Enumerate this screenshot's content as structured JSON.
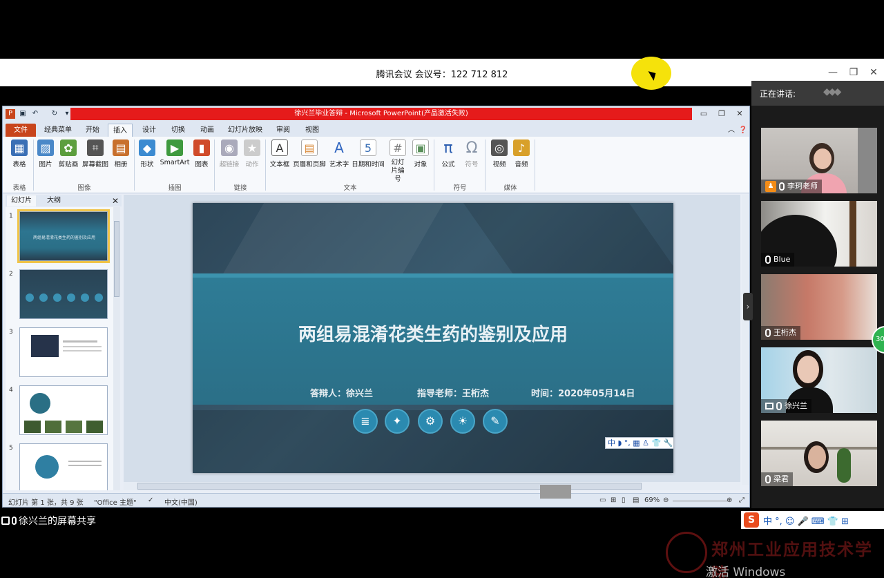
{
  "meeting": {
    "title": "腾讯会议 会议号：122 712 812"
  },
  "ppt": {
    "window_title": "徐兴兰毕业答辩 - Microsoft PowerPoint(产品激活失败)",
    "tabs": [
      "文件",
      "经典菜单",
      "开始",
      "插入",
      "设计",
      "切换",
      "动画",
      "幻灯片放映",
      "审阅",
      "视图"
    ],
    "ribbon_buttons": [
      {
        "label": "表格",
        "icon": "table-icon",
        "color": "#3a6fb5"
      },
      {
        "label": "图片",
        "icon": "picture-icon",
        "color": "#4a88c8"
      },
      {
        "label": "剪贴画",
        "icon": "clipart-icon",
        "color": "#5c9e3e"
      },
      {
        "label": "屏幕截图",
        "icon": "screenshot-icon",
        "color": "#555"
      },
      {
        "label": "相册",
        "icon": "album-icon",
        "color": "#c8702d"
      },
      {
        "label": "形状",
        "icon": "shapes-icon",
        "color": "#3c8bd1"
      },
      {
        "label": "SmartArt",
        "icon": "smartart-icon",
        "color": "#3f9a3f"
      },
      {
        "label": "图表",
        "icon": "chart-icon",
        "color": "#d04b2a"
      },
      {
        "label": "超链接",
        "icon": "hyperlink-icon",
        "color": "#9aa"
      },
      {
        "label": "动作",
        "icon": "action-icon",
        "color": "#bbb"
      },
      {
        "label": "文本框",
        "icon": "textbox-icon",
        "color": "#445"
      },
      {
        "label": "页眉和页脚",
        "icon": "header-footer-icon",
        "color": "#d98a3a"
      },
      {
        "label": "艺术字",
        "icon": "wordart-icon",
        "color": "#2f65c0"
      },
      {
        "label": "日期和时间",
        "icon": "datetime-icon",
        "color": "#3a6fb5"
      },
      {
        "label": "幻灯片编号",
        "icon": "slide-number-icon",
        "color": "#777"
      },
      {
        "label": "对象",
        "icon": "object-icon",
        "color": "#5a8f5a"
      },
      {
        "label": "公式",
        "icon": "equation-icon",
        "color": "#2a5db0"
      },
      {
        "label": "符号",
        "icon": "symbol-icon",
        "color": "#9aa"
      },
      {
        "label": "视频",
        "icon": "video-icon",
        "color": "#555"
      },
      {
        "label": "音频",
        "icon": "audio-icon",
        "color": "#d8a02a"
      }
    ],
    "groups": [
      "表格",
      "图像",
      "插图",
      "链接",
      "文本",
      "符号",
      "媒体"
    ],
    "pane_tabs": [
      "幻灯片",
      "大纲"
    ],
    "thumb_numbers": [
      "1",
      "2",
      "3",
      "4",
      "5"
    ],
    "slide": {
      "title": "两组易混淆花类生药的鉴别及应用",
      "presenter": "答辩人：徐兴兰",
      "advisor": "指导老师：王桁杰",
      "date": "时间：2020年05月14日"
    },
    "ime_bar": "中 ◗ °, ▦ ♙ 👕 🔧",
    "status": {
      "slide_info": "幻灯片 第 1 张，共 9 张",
      "theme": "\"Office 主题\"",
      "language": "中文(中国)",
      "zoom": "69%"
    }
  },
  "speakers": {
    "label": "正在讲话:",
    "participants": [
      {
        "name": "李珂老师"
      },
      {
        "name": "Blue"
      },
      {
        "name": "王桁杰"
      },
      {
        "name": "徐兴兰"
      },
      {
        "name": "梁君"
      }
    ]
  },
  "share_label": "徐兴兰的屏幕共享",
  "green_badge": "30",
  "sogou": "中 °, ☺ 🎤 ⌨ 👕 ⊞",
  "watermark": "郑州工业应用技术学院",
  "activate_text": "激活 Windows"
}
